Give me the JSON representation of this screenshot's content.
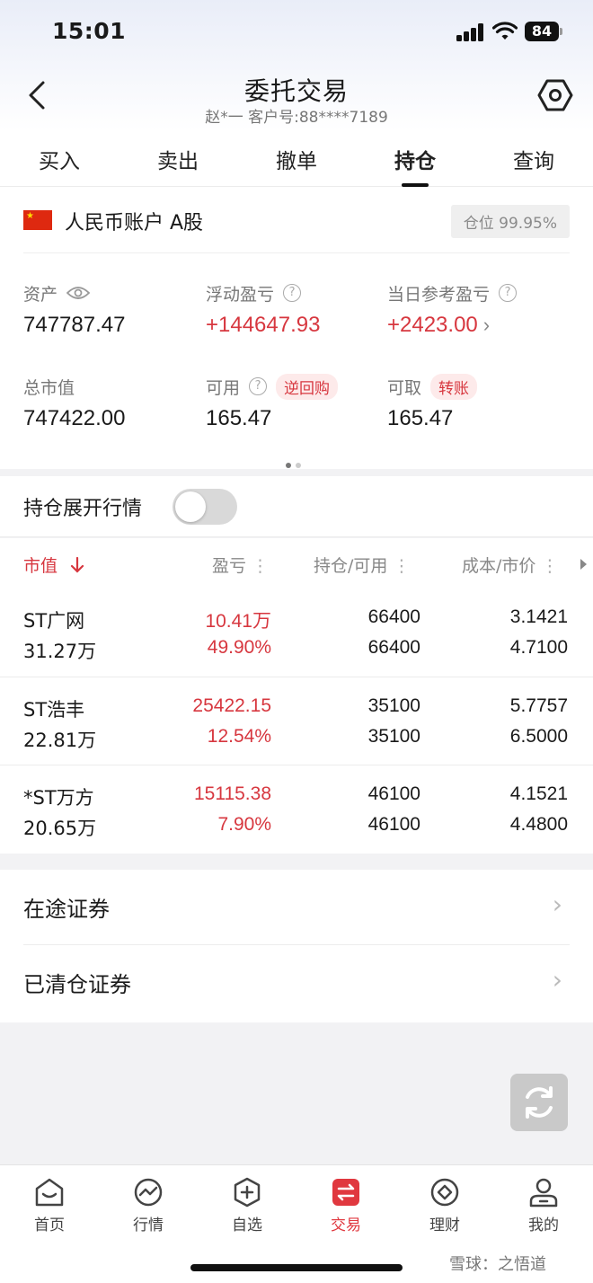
{
  "status_bar": {
    "time": "15:01",
    "battery": "84"
  },
  "header": {
    "title": "委托交易",
    "subtitle": "赵*一  客户号:88****7189"
  },
  "tabs": [
    {
      "label": "买入"
    },
    {
      "label": "卖出"
    },
    {
      "label": "撤单"
    },
    {
      "label": "持仓",
      "active": true
    },
    {
      "label": "查询"
    }
  ],
  "account": {
    "name": "人民币账户 A股",
    "position_ratio": "仓位 99.95%",
    "assets_label": "资产",
    "assets_value": "747787.47",
    "float_pl_label": "浮动盈亏",
    "float_pl_value": "+144647.93",
    "today_pl_label": "当日参考盈亏",
    "today_pl_value": "+2423.00",
    "market_value_label": "总市值",
    "market_value": "747422.00",
    "available_label": "可用",
    "available_value": "165.47",
    "reverse_repo_label": "逆回购",
    "withdrawable_label": "可取",
    "withdrawable_value": "165.47",
    "transfer_label": "转账"
  },
  "expand_toggle": {
    "label": "持仓展开行情",
    "on": false
  },
  "holdings": {
    "columns": {
      "market_value": "市值",
      "pl": "盈亏",
      "holding": "持仓/可用",
      "cost": "成本/市价"
    },
    "rows": [
      {
        "name": "ST广网",
        "mv": "31.27万",
        "pl": "10.41万",
        "pl_pct": "49.90%",
        "hold": "66400",
        "avail": "66400",
        "cost": "3.1421",
        "price": "4.7100"
      },
      {
        "name": "ST浩丰",
        "mv": "22.81万",
        "pl": "25422.15",
        "pl_pct": "12.54%",
        "hold": "35100",
        "avail": "35100",
        "cost": "5.7757",
        "price": "6.5000"
      },
      {
        "name": "*ST万方",
        "mv": "20.65万",
        "pl": "15115.38",
        "pl_pct": "7.90%",
        "hold": "46100",
        "avail": "46100",
        "cost": "4.1521",
        "price": "4.4800"
      }
    ]
  },
  "links": [
    {
      "label": "在途证券"
    },
    {
      "label": "已清仓证券"
    }
  ],
  "bottom_nav": [
    {
      "label": "首页",
      "icon": "home-icon"
    },
    {
      "label": "行情",
      "icon": "market-icon"
    },
    {
      "label": "自选",
      "icon": "watchlist-icon"
    },
    {
      "label": "交易",
      "icon": "trade-icon",
      "active": true
    },
    {
      "label": "理财",
      "icon": "wealth-icon"
    },
    {
      "label": "我的",
      "icon": "profile-icon"
    }
  ],
  "watermark": "雪球：之悟道",
  "colors": {
    "accent_red": "#d7373f",
    "trade_active": "#e0383f"
  }
}
